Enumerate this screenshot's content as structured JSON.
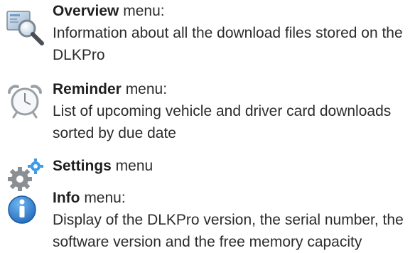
{
  "menus": [
    {
      "id": "overview",
      "icon": "overview-magnifier-icon",
      "title": "Overview",
      "suffix": " menu:",
      "description": "Information about all the download files stored on the DLKPro"
    },
    {
      "id": "reminder",
      "icon": "alarm-clock-icon",
      "title": "Reminder",
      "suffix": " menu:",
      "description": "List of upcoming vehicle and driver card downloads sorted by due date"
    },
    {
      "id": "settings",
      "icon": "gears-icon",
      "title": "Settings",
      "suffix": " menu",
      "description": ""
    },
    {
      "id": "info",
      "icon": "info-icon",
      "title": "Info",
      "suffix": " menu:",
      "description": "Display of the DLKPro version, the serial number, the software version and the free memory capacity"
    }
  ],
  "colors": {
    "text": "#2b2b2b",
    "info_blue": "#2a7bd3",
    "gear_gray": "#8a8f94",
    "gear_blue": "#3d9be8",
    "clock_gray": "#9aa0a6",
    "screen_blue": "#6f9fc9"
  }
}
